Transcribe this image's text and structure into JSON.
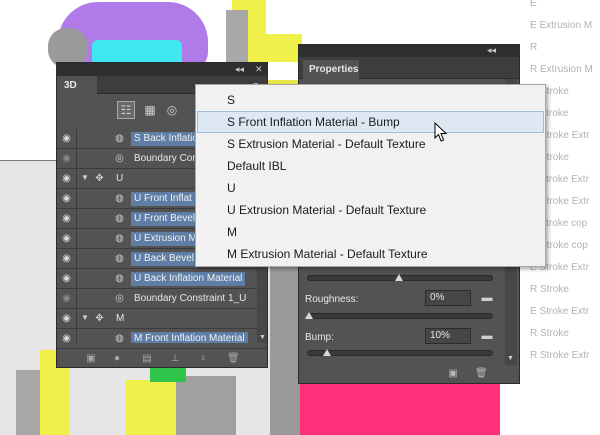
{
  "colors": {
    "panel_bg": "#535353",
    "panel_dark": "#2f2f2f",
    "selection_blue": "#5f7ea6",
    "dropdown_bg": "#f1f1f1",
    "dropdown_hover": "#dde8f3",
    "shape_purple": "#b07be8",
    "shape_cyan": "#3ee8ee",
    "shape_yellow": "#f0f04a",
    "shape_magenta": "#ff2f7a",
    "shape_green": "#2ec44a"
  },
  "layer_list": {
    "rows": [
      "E",
      "E Extrusion M",
      "R",
      "R Extrusion M",
      "R Stroke",
      "E Stroke",
      "R Stroke Extr",
      "R Stroke",
      "E Stroke Extr",
      "R Stroke Extr",
      "E Stroke cop",
      "R Stroke cop",
      "E Stroke Extr",
      "R Stroke",
      "E Stroke Extr",
      "R Stroke",
      "R Stroke Extr"
    ]
  },
  "panel_3d": {
    "tab": "3D",
    "collapse_icon": "double-chevron-icon",
    "close_icon": "close-icon",
    "rows": [
      {
        "label": "S Back Inflatio",
        "type": "material",
        "eye": true
      },
      {
        "label": "Boundary Con",
        "type": "constraint",
        "eye": false
      },
      {
        "label": "U",
        "type": "mesh",
        "eye": true
      },
      {
        "label": "U Front Inflat",
        "type": "material",
        "eye": true
      },
      {
        "label": "U Front Bevel",
        "type": "material",
        "eye": true
      },
      {
        "label": "U Extrusion M",
        "type": "material",
        "eye": true
      },
      {
        "label": "U Back Bevel",
        "type": "material",
        "eye": true
      },
      {
        "label": "U Back Inflation Material",
        "type": "material",
        "eye": true
      },
      {
        "label": "Boundary Constraint 1_U",
        "type": "constraint",
        "eye": false
      },
      {
        "label": "M",
        "type": "mesh",
        "eye": true
      },
      {
        "label": "M Front Inflation Material",
        "type": "material",
        "eye": true
      }
    ]
  },
  "panel_props": {
    "tab": "Properties",
    "roughness_label": "Roughness:",
    "roughness_value": "0%",
    "roughness_level": 0,
    "bump_label": "Bump:",
    "bump_value": "10%",
    "bump_level": 0.1,
    "top_slider_level": 0.5
  },
  "dropdown": {
    "items": [
      "S",
      "S Front Inflation Material - Bump",
      "S Extrusion Material - Default Texture",
      "Default IBL",
      "U",
      "U Extrusion Material - Default Texture",
      "M",
      "M Extrusion Material - Default Texture"
    ],
    "hovered_index": 1
  }
}
